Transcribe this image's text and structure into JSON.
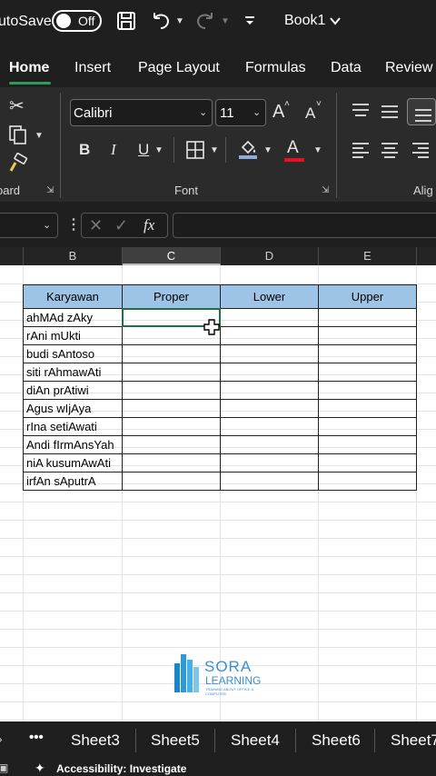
{
  "titlebar": {
    "autosave_label": "utoSave",
    "toggle_state": "Off",
    "workbook_name": "Book1"
  },
  "tabs": [
    "Home",
    "Insert",
    "Page Layout",
    "Formulas",
    "Data",
    "Review"
  ],
  "ribbon": {
    "font_name": "Calibri",
    "font_size": "11",
    "group_clipboard": "oard",
    "group_font": "Font",
    "group_alignment": "Alig",
    "grow_font": "A",
    "shrink_font": "A",
    "bold": "B",
    "italic": "I",
    "underline": "U",
    "font_color_letter": "A"
  },
  "formula_bar": {
    "fx": "fx",
    "content": ""
  },
  "columns": [
    "B",
    "C",
    "D",
    "E"
  ],
  "table": {
    "headers": [
      "Karyawan",
      "Proper",
      "Lower",
      "Upper"
    ],
    "rows": [
      "ahMAd zAky",
      "rAni mUkti",
      "budi sAntoso",
      "siti rAhmawAti",
      "diAn prAtiwi",
      "Agus wIjAya",
      "rIna setiAwati",
      "Andi fIrmAnsYah",
      "niA kusumAwAti",
      "irfAn sAputrA"
    ]
  },
  "logo": {
    "line1": "SORA",
    "line2": "LEARNING",
    "line3": "TRAINING ABOUT OFFICE & COMPUTER"
  },
  "sheets": {
    "more": "•••",
    "names": [
      "Sheet3",
      "Sheet5",
      "Sheet4",
      "Sheet6",
      "Sheet7"
    ]
  },
  "status": {
    "accessibility": "Accessibility: Investigate"
  },
  "colors": {
    "header_fill": "#9dc3e6",
    "selection": "#1e7145",
    "chrome": "#1f1f1f",
    "accent_tab": "#2e9b5c",
    "font_color_bar": "#e81123",
    "fill_color_bar": "#8faadc"
  }
}
